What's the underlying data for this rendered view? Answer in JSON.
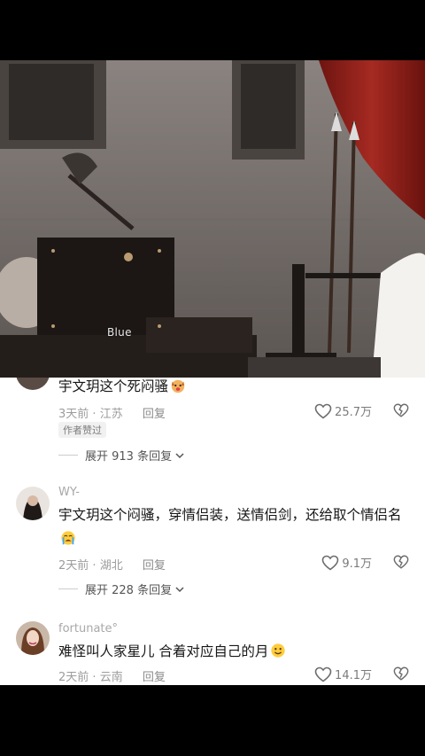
{
  "video": {
    "watermark": "Blue"
  },
  "comments": [
    {
      "text": "宇文玥这个死闷骚",
      "emoji": "dog-face",
      "time": "3天前",
      "location": "江苏",
      "reply_label": "回复",
      "likes": "25.7万",
      "badge": "作者赞过",
      "expand": "展开 913 条回复"
    },
    {
      "username": "WY-",
      "text": "宇文玥这个闷骚，穿情侣装，送情侣剑，还给取个情侣名",
      "emoji": "crying-face",
      "time": "2天前",
      "location": "湖北",
      "reply_label": "回复",
      "likes": "9.1万",
      "expand": "展开 228 条回复"
    },
    {
      "username": "fortunate°",
      "text": "难怪叫人家星儿 合着对应自己的月",
      "emoji": "smiling-face",
      "time": "2天前",
      "location": "云南",
      "reply_label": "回复",
      "likes": "14.1万"
    }
  ],
  "colors": {
    "sheet_bg": "#ffffff",
    "text": "#161616",
    "meta": "#9c9c9c",
    "curtain": "#8e1f1a"
  }
}
